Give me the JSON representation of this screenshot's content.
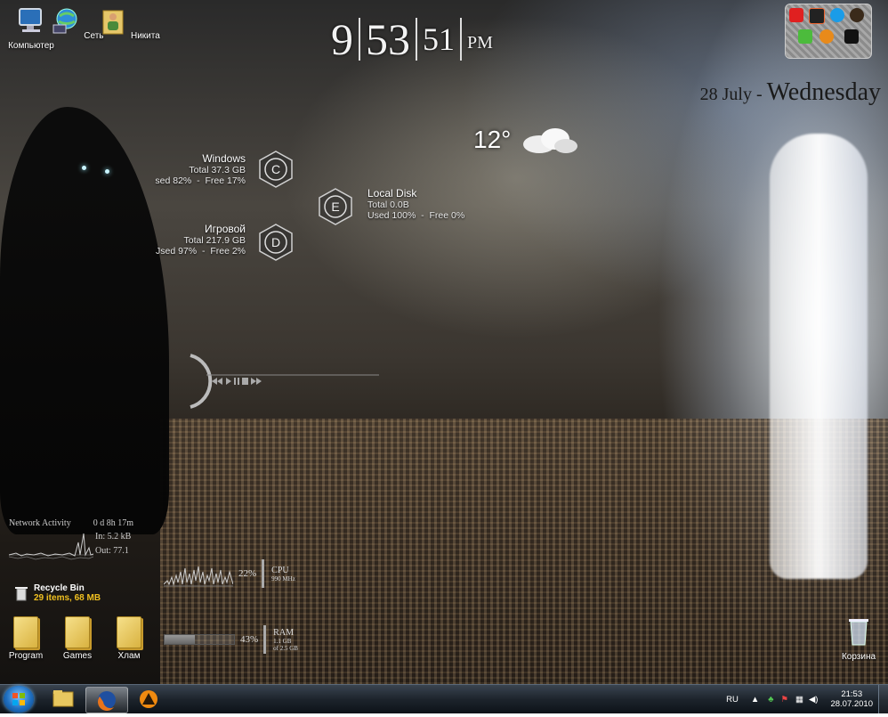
{
  "desktop_icons": [
    {
      "label": "Компьютер",
      "icon": "computer-icon"
    },
    {
      "label": "Сеть",
      "icon": "network-globe-icon"
    },
    {
      "label": "Никита",
      "icon": "user-folder-icon"
    }
  ],
  "clock": {
    "hour": "9",
    "minute": "53",
    "second": "51",
    "ampm": "PM"
  },
  "date": {
    "day_month": "28 July",
    "separator": " - ",
    "weekday": "Wednesday"
  },
  "weather": {
    "temperature": "12°",
    "icon": "cloud-icon"
  },
  "disks": [
    {
      "name": "Windows",
      "letter": "C",
      "total": "Total 37.3 GB",
      "usage": "sed 82%",
      "free": "Free 17%"
    },
    {
      "name": "Local Disk",
      "letter": "E",
      "total": "Total 0.0B",
      "usage": "Used 100%",
      "free": "Free 0%"
    },
    {
      "name": "Игровой",
      "letter": "D",
      "total": "Total 217.9 GB",
      "usage": "Jsed 97%",
      "free": "Free 2%"
    }
  ],
  "disk_separator": "-",
  "media_player": {
    "controls": [
      "previous",
      "play",
      "pause",
      "stop",
      "next"
    ]
  },
  "network": {
    "title": "Network Activity",
    "uptime": "0 d 8h 17m",
    "in": "In: 5.2 kB",
    "out": "Out: 77.1"
  },
  "cpu": {
    "percent": "22%",
    "label": "CPU",
    "detail": "990 MHz"
  },
  "ram": {
    "percent": "43%",
    "label": "RAM",
    "detail_used": "1.1 GB",
    "detail_total": "of 2.5 GB",
    "fill": 0.43
  },
  "recycle_bin": {
    "title": "Recycle Bin",
    "status": "29 items, 68 MB"
  },
  "folders": [
    {
      "label": "Program"
    },
    {
      "label": "Games"
    },
    {
      "label": "Хлам"
    }
  ],
  "trash_icon": {
    "label": "Корзина"
  },
  "taskbar": {
    "pinned": [
      "explorer-icon",
      "firefox-icon",
      "aimp-icon"
    ],
    "active_index": 1
  },
  "tray": {
    "language": "RU",
    "time": "21:53",
    "date": "28.07.2010"
  },
  "colors": {
    "taskbar": "#1d242c",
    "recycle_status": "#f0c020",
    "accent": "#1f6fc0"
  }
}
